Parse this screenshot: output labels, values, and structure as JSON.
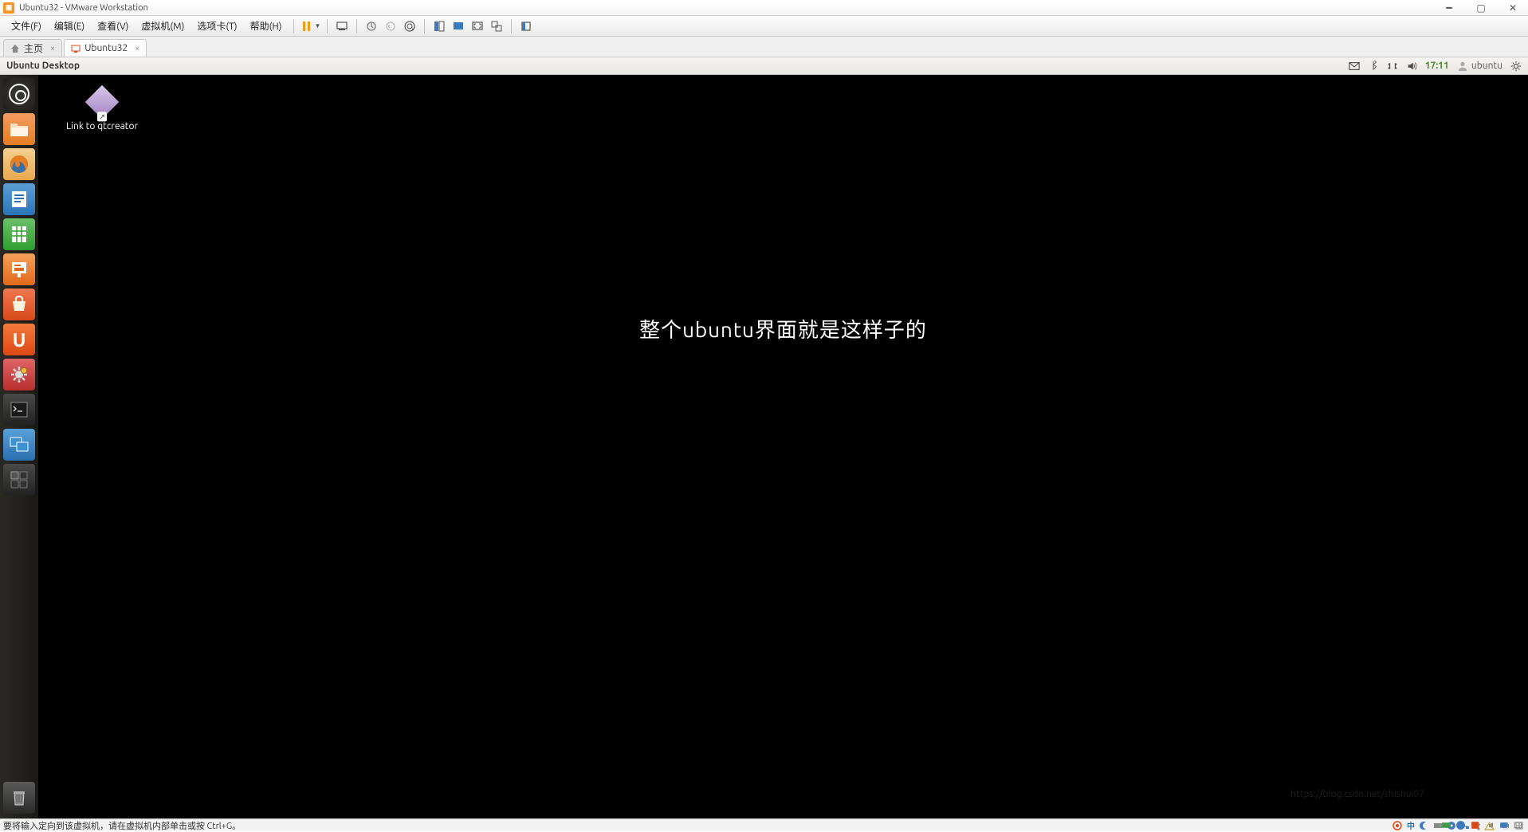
{
  "vmware": {
    "title": "Ubuntu32 - VMware Workstation",
    "menus": {
      "file": "文件(F)",
      "edit": "编辑(E)",
      "view": "查看(V)",
      "vm": "虚拟机(M)",
      "tabs": "选项卡(T)",
      "help": "帮助(H)"
    },
    "tabs": {
      "home": "主页",
      "active": "Ubuntu32"
    },
    "status": "要将输入定向到该虚拟机，请在虚拟机内部单击或按 Ctrl+G。"
  },
  "ubuntu": {
    "panel_title": "Ubuntu Desktop",
    "time": "17:11",
    "user": "ubuntu",
    "desktop_icon_label": "Link to qtcreator",
    "launcher": {
      "dash": "Dash",
      "files": "Files",
      "firefox": "Firefox",
      "writer": "LibreOffice Writer",
      "calc": "LibreOffice Calc",
      "impress": "LibreOffice Impress",
      "software": "Ubuntu Software Center",
      "uone": "U",
      "settings": "System Settings",
      "terminal": "Terminal",
      "display": "Displays",
      "workspace": "Workspace Switcher",
      "trash": "Trash"
    }
  },
  "annotation": "整个ubuntu界面就是这样子的",
  "ime_label": "中",
  "watermark": "https://blog.csdn.net/shishui07"
}
